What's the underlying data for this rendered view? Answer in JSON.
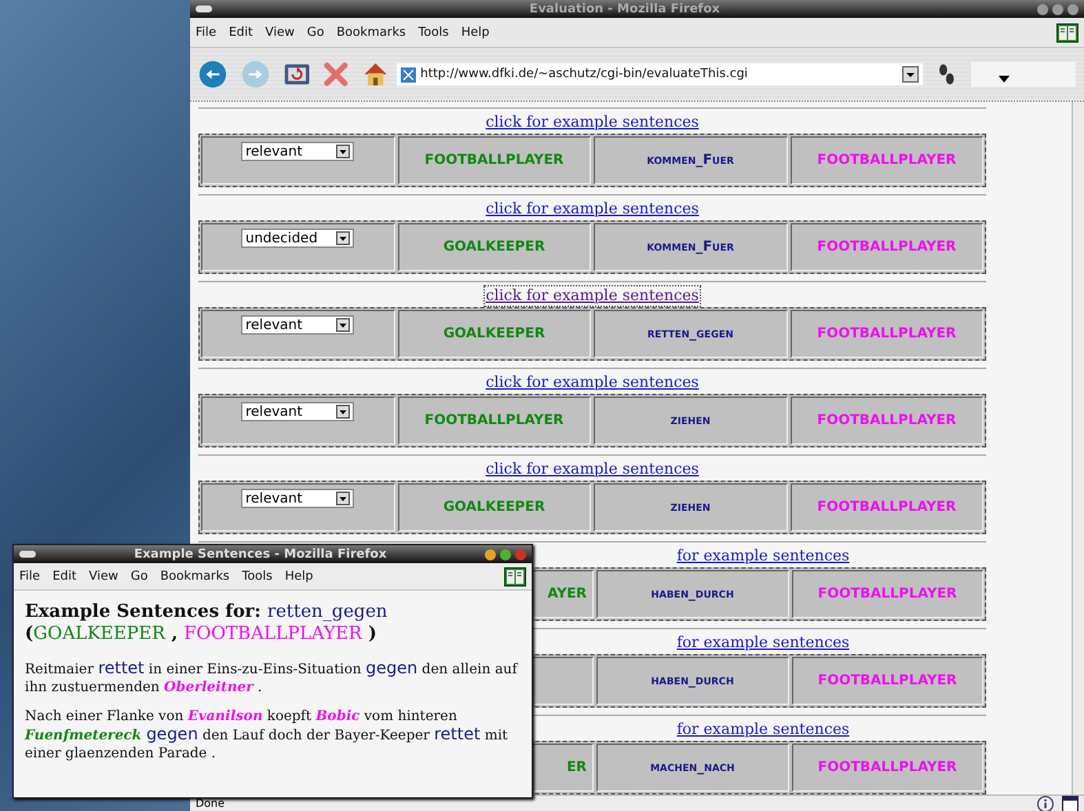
{
  "window": {
    "title": "Evaluation - Mozilla Firefox"
  },
  "menu": [
    "File",
    "Edit",
    "View",
    "Go",
    "Bookmarks",
    "Tools",
    "Help"
  ],
  "toolbar": {
    "back_disabled": false,
    "forward_disabled": true,
    "url": "http://www.dfki.de/~aschutz/cgi-bin/evaluateThis.cgi"
  },
  "rows": [
    {
      "link": "click for example sentences",
      "focused": false,
      "choice": "relevant",
      "arg1": "FOOTBALLPLAYER",
      "verb": "kommen_Fuer",
      "arg2": "FOOTBALLPLAYER"
    },
    {
      "link": "click for example sentences",
      "focused": false,
      "choice": "undecided",
      "arg1": "GOALKEEPER",
      "verb": "kommen_Fuer",
      "arg2": "FOOTBALLPLAYER"
    },
    {
      "link": "click for example sentences",
      "focused": true,
      "choice": "relevant",
      "arg1": "GOALKEEPER",
      "verb": "retten_gegen",
      "arg2": "FOOTBALLPLAYER"
    },
    {
      "link": "click for example sentences",
      "focused": false,
      "choice": "relevant",
      "arg1": "FOOTBALLPLAYER",
      "verb": "ziehen",
      "arg2": "FOOTBALLPLAYER"
    },
    {
      "link": "click for example sentences",
      "focused": false,
      "choice": "relevant",
      "arg1": "GOALKEEPER",
      "verb": "ziehen",
      "arg2": "FOOTBALLPLAYER"
    },
    {
      "link": "for example sentences",
      "focused": false,
      "arg1": "AYER",
      "verb": "haben_durch",
      "arg2": "FOOTBALLPLAYER"
    },
    {
      "link": "for example sentences",
      "focused": false,
      "verb": "haben_durch",
      "arg2": "FOOTBALLPLAYER"
    },
    {
      "link": "for example sentences",
      "focused": false,
      "arg1": "ER",
      "verb": "machen_nach",
      "arg2": "FOOTBALLPLAYER"
    }
  ],
  "status_bar": {
    "text": "Done"
  },
  "popup": {
    "title": "Example Sentences - Mozilla Firefox",
    "menu": [
      "File",
      "Edit",
      "View",
      "Go",
      "Bookmarks",
      "Tools",
      "Help"
    ],
    "heading": [
      {
        "kind": "plain",
        "text": "Example Sentences for: "
      },
      {
        "kind": "verb",
        "text": "retten_gegen"
      },
      {
        "kind": "break"
      },
      {
        "kind": "plain",
        "text": "("
      },
      {
        "kind": "arg1",
        "text": "GOALKEEPER"
      },
      {
        "kind": "plain",
        "text": " , "
      },
      {
        "kind": "arg2",
        "text": "FOOTBALLPLAYER"
      },
      {
        "kind": "plain",
        "text": " )"
      }
    ],
    "sentences": [
      [
        {
          "kind": "plain",
          "text": "Reitmaier "
        },
        {
          "kind": "verb",
          "text": "rettet"
        },
        {
          "kind": "plain",
          "text": " in einer Eins-zu-Eins-Situation "
        },
        {
          "kind": "verb",
          "text": "gegen"
        },
        {
          "kind": "plain",
          "text": " den allein auf ihn zustuermenden "
        },
        {
          "kind": "arg2",
          "text": "Oberleitner"
        },
        {
          "kind": "plain",
          "text": " ."
        }
      ],
      [
        {
          "kind": "plain",
          "text": "Nach einer Flanke von "
        },
        {
          "kind": "arg2",
          "text": "Evanilson"
        },
        {
          "kind": "plain",
          "text": " koepft "
        },
        {
          "kind": "arg2",
          "text": "Bobic"
        },
        {
          "kind": "plain",
          "text": " vom hinteren "
        },
        {
          "kind": "arg1",
          "text": "Fuenfmetereck "
        },
        {
          "kind": "verb",
          "text": "gegen"
        },
        {
          "kind": "plain",
          "text": " den Lauf doch der Bayer-Keeper "
        },
        {
          "kind": "verb",
          "text": "rettet"
        },
        {
          "kind": "plain",
          "text": " mit einer glaenzenden Parade ."
        }
      ]
    ]
  }
}
